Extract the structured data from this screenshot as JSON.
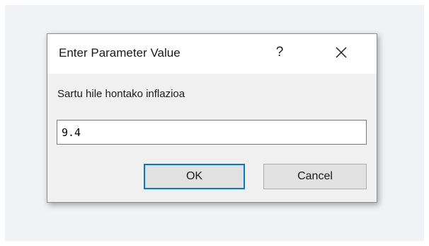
{
  "dialog": {
    "title": "Enter Parameter Value",
    "help_label": "?",
    "close_icon": "close-icon",
    "prompt": "Sartu hile hontako inflazioa",
    "input_value": "9.4",
    "ok_label": "OK",
    "cancel_label": "Cancel"
  },
  "colors": {
    "accent": "#0078d7",
    "dialog_bg": "#f0f0f0",
    "titlebar_bg": "#ffffff",
    "backdrop": "#f1f2f4"
  }
}
